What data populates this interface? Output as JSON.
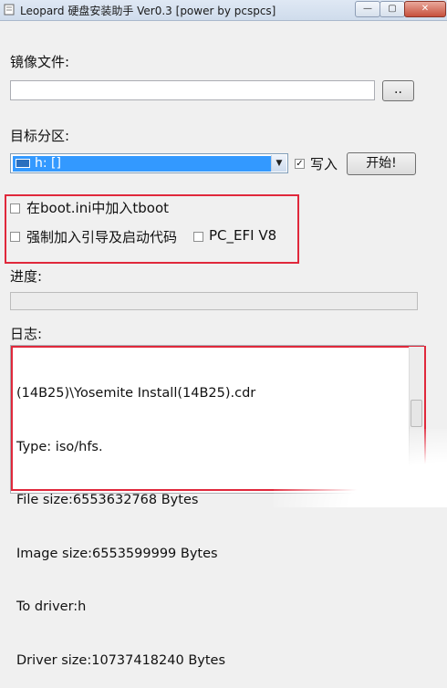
{
  "window": {
    "title": "Leopard 硬盘安装助手 Ver0.3 [power by pcspcs]",
    "minimize_glyph": "—",
    "maximize_glyph": "▢",
    "close_glyph": "✕"
  },
  "image_file": {
    "label": "镜像文件:",
    "value": "",
    "browse_label": ".."
  },
  "target_partition": {
    "label": "目标分区:",
    "selected": "h: []",
    "drive_icon": "drive-icon",
    "write_label": "写入",
    "write_checked": true,
    "start_label": "开始!"
  },
  "options": {
    "tboot_label": "在boot.ini中加入tboot",
    "tboot_checked": false,
    "force_boot_label": "强制加入引导及启动代码",
    "force_boot_checked": false,
    "pc_efi_label": "PC_EFI V8",
    "pc_efi_checked": false
  },
  "progress": {
    "label": "进度:",
    "value": 0
  },
  "log": {
    "label": "日志:",
    "lines": [
      "(14B25)\\Yosemite Install(14B25).cdr",
      "Type: iso/hfs.",
      "File size:6553632768 Bytes",
      "Image size:6553599999 Bytes",
      "To driver:h",
      "Driver size:10737418240 Bytes"
    ]
  },
  "colors": {
    "highlight_box": "#e0283b",
    "selection": "#3399ff"
  }
}
